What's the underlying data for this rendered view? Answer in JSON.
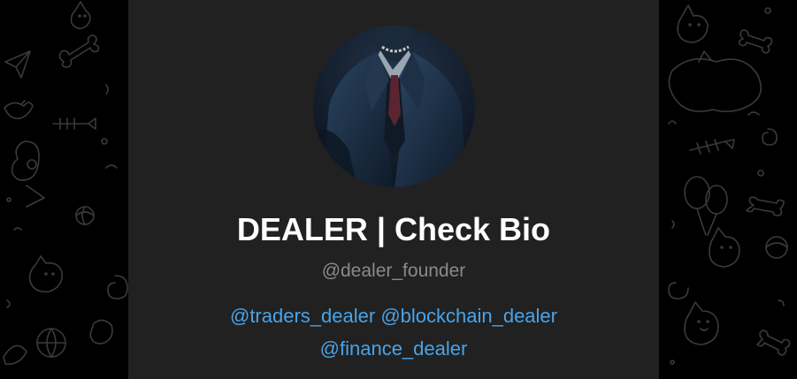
{
  "profile": {
    "name": "DEALER | Check Bio",
    "username": "@dealer_founder",
    "bio_links": [
      "@traders_dealer",
      "@blockchain_dealer",
      "@finance_dealer"
    ]
  },
  "colors": {
    "page_background": "#000000",
    "card_background": "#212121",
    "name_text": "#ffffff",
    "username_text": "#8a8a8a",
    "link": "#4aa3e8",
    "doodle_stroke": "#3a3a3a"
  },
  "icons": [
    "paper-plane-icon",
    "cat-icon",
    "fish-bone-icon",
    "balloon-icon",
    "bone-icon",
    "ball-icon",
    "bird-icon",
    "spiral-icon"
  ]
}
